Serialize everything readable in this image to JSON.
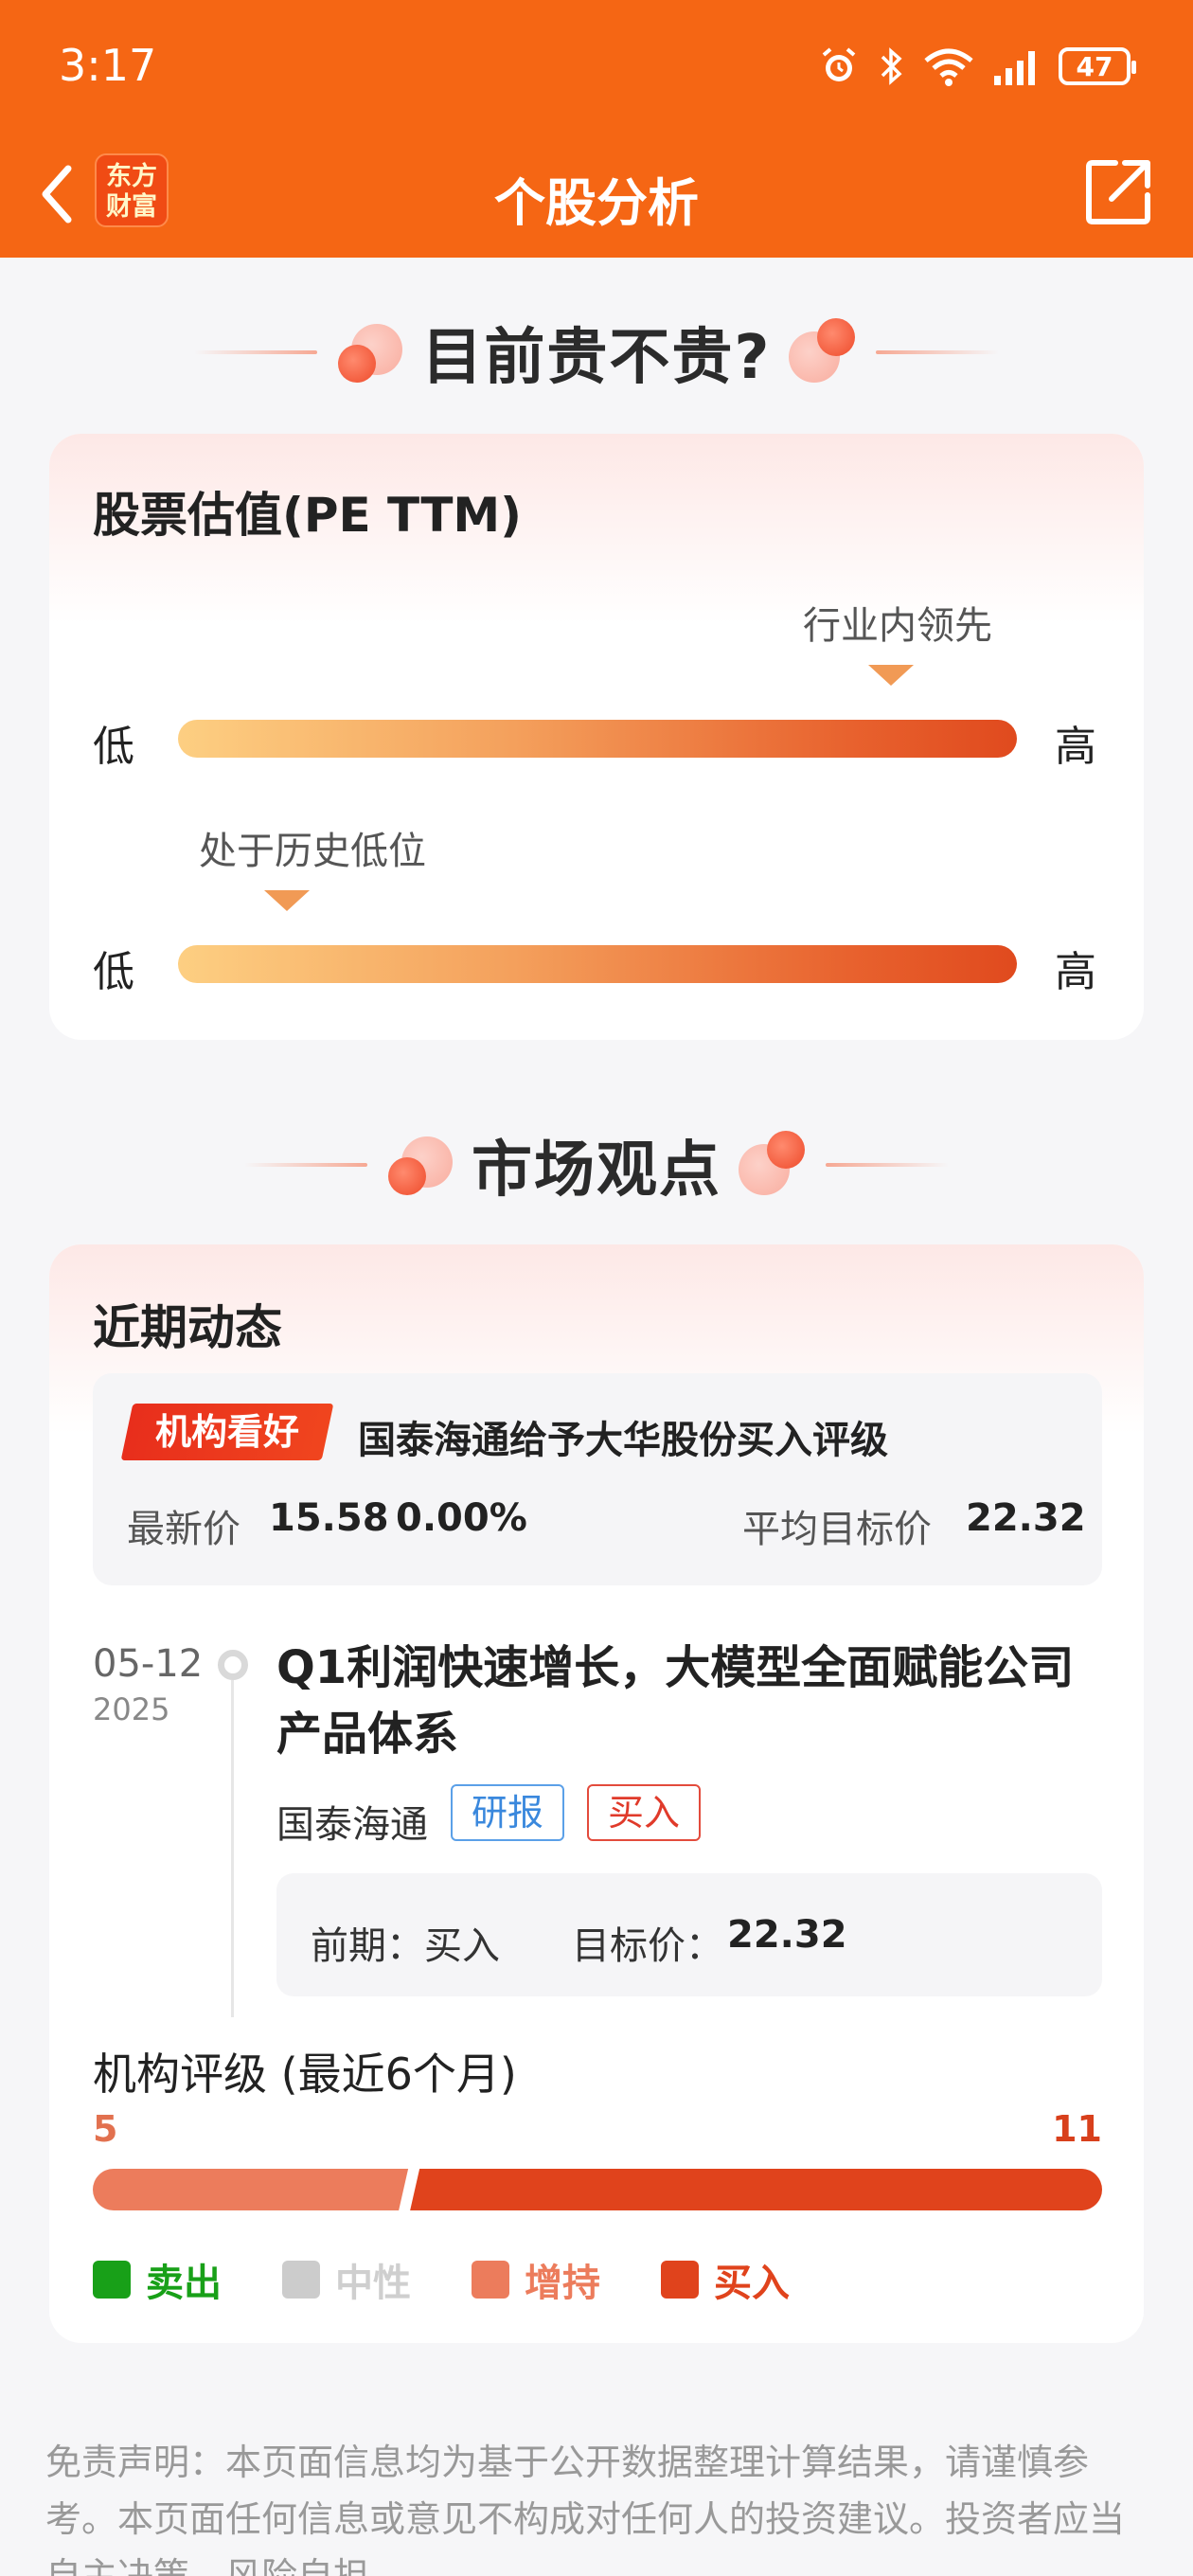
{
  "status_bar": {
    "time": "3:17",
    "battery": "47"
  },
  "nav": {
    "title": "个股分析",
    "logo_line1": "东方",
    "logo_line2": "财富"
  },
  "valuation_section": {
    "heading": "目前贵不贵?",
    "card_title": "股票估值(PE TTM)",
    "industry_scale": {
      "marker_label": "行业内领先",
      "low": "低",
      "high": "高",
      "position_pct": 85
    },
    "history_scale": {
      "marker_label": "处于历史低位",
      "low": "低",
      "high": "高",
      "position_pct": 13
    }
  },
  "market_section": {
    "heading": "市场观点",
    "card_title": "近期动态",
    "news": {
      "tag": "机构看好",
      "headline": "国泰海通给予大华股份买入评级",
      "latest_price_label": "最新价",
      "latest_price": "15.58",
      "change": "0.00%",
      "avg_target_label": "平均目标价",
      "avg_target": "22.32"
    },
    "report": {
      "date": "05-12",
      "year": "2025",
      "title": "Q1利润快速增长，大模型全面赋能公司产品体系",
      "broker": "国泰海通",
      "type_tag": "研报",
      "rating_tag": "买入",
      "previous_label": "前期：",
      "previous_value": "买入",
      "target_label": "目标价：",
      "target_value": "22.32"
    },
    "rating": {
      "title": "机构评级 (最近6个月)",
      "increase_count": "5",
      "buy_count": "11",
      "legend": [
        {
          "label": "卖出",
          "color": "#18a018"
        },
        {
          "label": "中性",
          "color": "#cccccc"
        },
        {
          "label": "增持",
          "color": "#ec7c5c"
        },
        {
          "label": "买入",
          "color": "#e0431c"
        }
      ]
    }
  },
  "disclaimer": "免责声明：本页面信息均为基于公开数据整理计算结果，请谨慎参考。本页面任何信息或意见不构成对任何人的投资建议。投资者应当自主决策，风险自担。"
}
